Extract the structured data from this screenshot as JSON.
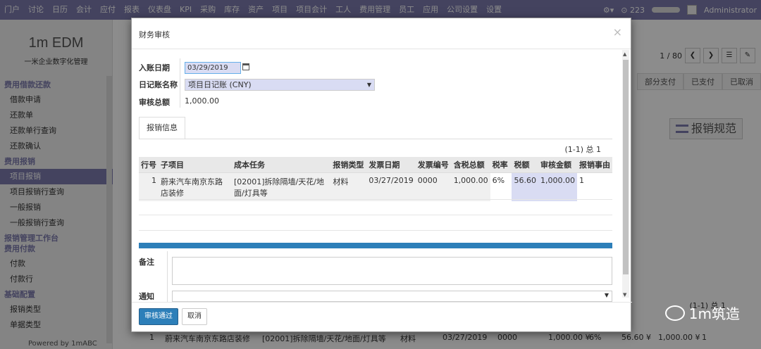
{
  "topnav": {
    "menu": [
      "门户",
      "讨论",
      "日历",
      "会计",
      "应付",
      "报表",
      "仪表盘",
      "KPI",
      "采购",
      "库存",
      "资产",
      "项目",
      "项目会计",
      "工人",
      "费用管理",
      "员工",
      "应用",
      "公司设置",
      "设置"
    ],
    "badge": "223",
    "user": "Administrator"
  },
  "sidebar": {
    "logo_title": "1m EDM",
    "logo_subtitle": "一米企业数字化管理",
    "groups": [
      {
        "head": "费用借款还款",
        "items": [
          "借款申请",
          "还款单",
          "还款单行查询",
          "还款确认"
        ]
      },
      {
        "head": "费用报销",
        "items": [
          "项目报销",
          "项目报销行查询",
          "一般报销",
          "一般报销行查询"
        ]
      },
      {
        "head": "报销管理工作台",
        "items": []
      },
      {
        "head": "费用付款",
        "items": [
          "付款",
          "付款行"
        ]
      },
      {
        "head": "基础配置",
        "items": [
          "报销类型",
          "单据类型"
        ]
      }
    ],
    "footer": "Powered by 1mABC"
  },
  "background": {
    "pager": "1 / 80",
    "statuses": [
      "部分支付",
      "已支付",
      "已取消"
    ],
    "rule_button": "报销规范",
    "count": "(1-1) 总 1",
    "bottom_row": [
      "1",
      "蔚来汽车南京东路店装修",
      "[02001]拆除隔墙/天花/地面/灯具等",
      "材料",
      "03/27/2019",
      "0000",
      "1,000.00 ¥",
      "6%",
      "56.60 ¥",
      "1,000.00 ¥",
      "1"
    ]
  },
  "modal": {
    "title": "财务审核",
    "close": "×",
    "fields": {
      "date_label": "入账日期",
      "date_value": "03/29/2019",
      "journal_label": "日记账名称",
      "journal_value": "项目日记账 (CNY)",
      "total_label": "审核总额",
      "total_value": "1,000.00"
    },
    "tab": "报销信息",
    "table_count": "(1-1) 总 1",
    "columns": [
      "行号",
      "子项目",
      "成本任务",
      "报销类型",
      "发票日期",
      "发票编号",
      "含税总额",
      "税率",
      "税额",
      "审核金额",
      "报销事由"
    ],
    "rows": [
      [
        "1",
        "蔚来汽车南京东路店装修",
        "[02001]拆除隔墙/天花/地面/灯具等",
        "材料",
        "03/27/2019",
        "0000",
        "1,000.00",
        "6%",
        "56.60",
        "1,000.00",
        "1"
      ]
    ],
    "note_label": "备注",
    "notify_label": "通知",
    "approve_button": "审核通过",
    "cancel_button": "取消"
  },
  "watermark": "1m筑造"
}
